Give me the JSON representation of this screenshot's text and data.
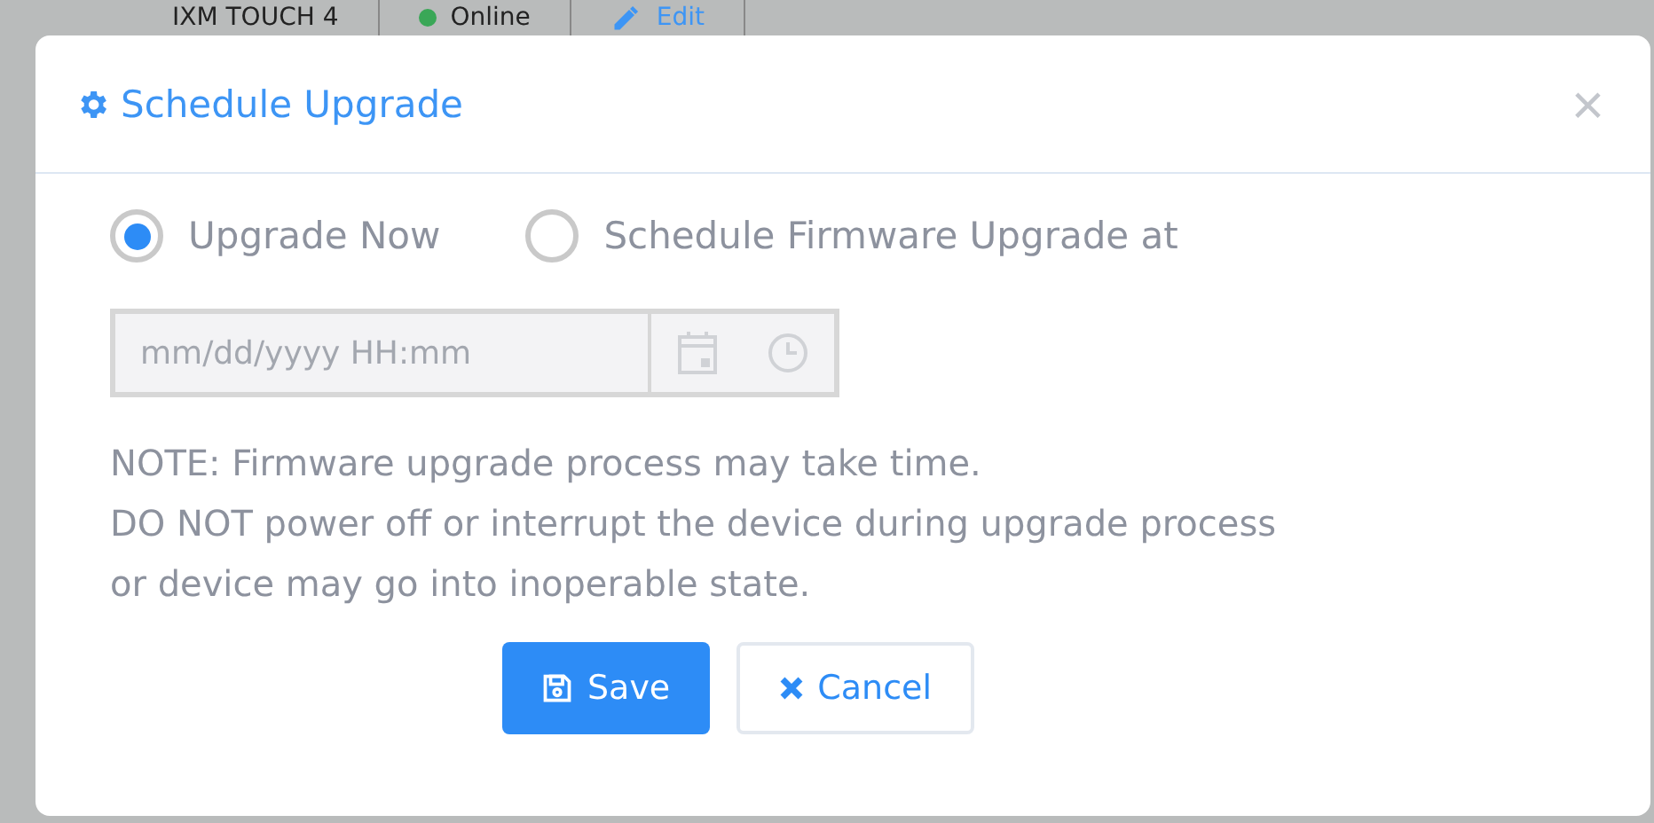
{
  "background_row": {
    "device": "IXM TOUCH 4",
    "status": {
      "label": "Online",
      "color": "#3aa757"
    },
    "edit_link": "Edit"
  },
  "dialog": {
    "title": "Schedule Upgrade",
    "close": "×",
    "options": [
      {
        "label": "Upgrade Now",
        "selected": true
      },
      {
        "label": "Schedule Firmware Upgrade at",
        "selected": false
      }
    ],
    "datetime": {
      "placeholder": "mm/dd/yyyy HH:mm",
      "disabled": true
    },
    "note": [
      "NOTE: Firmware upgrade process may take time.",
      "DO NOT power off or interrupt the device during upgrade process",
      "or device may go into inoperable state."
    ],
    "buttons": [
      {
        "kind": "primary",
        "label": "Save"
      },
      {
        "kind": "secondary",
        "label": "Cancel"
      }
    ]
  }
}
